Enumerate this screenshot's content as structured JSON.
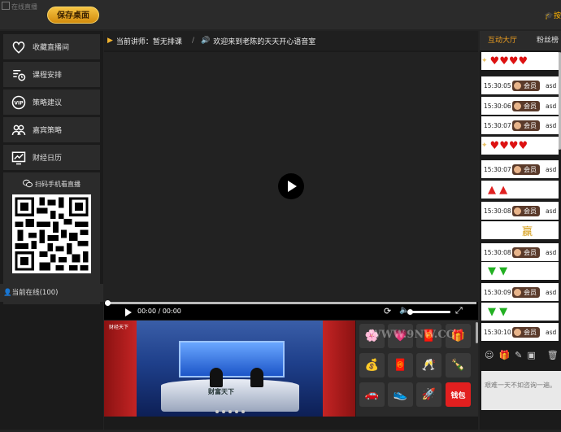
{
  "header": {
    "logo_alt": "在线直播",
    "save_desktop_label": "保存桌面",
    "top_right_label": "按"
  },
  "sidebar": {
    "items": [
      {
        "label": "收藏直播间",
        "icon": "heart-icon"
      },
      {
        "label": "课程安排",
        "icon": "schedule-icon"
      },
      {
        "label": "策略建议",
        "icon": "vip-icon"
      },
      {
        "label": "嘉宾策略",
        "icon": "guests-icon"
      },
      {
        "label": "财经日历",
        "icon": "chart-icon"
      }
    ],
    "qr_title": "扫码手机看直播",
    "online_text": "当前在线(100)"
  },
  "main": {
    "current_teacher": "当前讲师：暂无排课",
    "welcome": "欢迎来到老陈的天天开心语音室",
    "player": {
      "time": "00:00 / 00:00",
      "volume": 1.0,
      "progress": 0.0
    },
    "thumbnail_caption": "财富天下",
    "thumbnail_brand": "财经天下",
    "gifts": {
      "watermark": "WWW.9NW.CC",
      "wallet_label": "钱包",
      "items": [
        "flower-gift-icon",
        "heart-gift-icon",
        "envelope-gift-icon",
        "gold-ingot-gift-icon",
        "red-packet-gift-icon",
        "wine-gift-icon",
        "drink-gift-icon",
        "car-gift-icon",
        "shoe-gift-icon",
        "rocket-gift-icon"
      ]
    }
  },
  "chat": {
    "tabs": {
      "active": "互动大厅",
      "inactive": "粉丝榜"
    },
    "messages": [
      {
        "type": "emoji",
        "content": "♥♥♥♥"
      },
      {
        "type": "msg",
        "time": "15:30:05",
        "badge": "会员",
        "user": "asd"
      },
      {
        "type": "msg",
        "time": "15:30:06",
        "badge": "会员",
        "user": "asd"
      },
      {
        "type": "msg",
        "time": "15:30:07",
        "badge": "会员",
        "user": "asd"
      },
      {
        "type": "emoji",
        "content": "♥♥♥♥"
      },
      {
        "type": "msg",
        "time": "15:30:07",
        "badge": "会员",
        "user": "asd"
      },
      {
        "type": "arrows-up",
        "content": "▲ ▲"
      },
      {
        "type": "msg",
        "time": "15:30:08",
        "badge": "会员",
        "user": "asd"
      },
      {
        "type": "emoji-text",
        "content": "赢"
      },
      {
        "type": "msg",
        "time": "15:30:08",
        "badge": "会员",
        "user": "asd"
      },
      {
        "type": "arrows-down",
        "content": "▼ ▼"
      },
      {
        "type": "msg",
        "time": "15:30:09",
        "badge": "会员",
        "user": "asd"
      },
      {
        "type": "arrows-down",
        "content": "▼ ▼"
      },
      {
        "type": "msg",
        "time": "15:30:10",
        "badge": "会员",
        "user": "asd"
      }
    ],
    "toolbar_icons": [
      "smile-icon",
      "gift-icon",
      "broom-icon",
      "image-icon",
      "trash-icon"
    ],
    "input_placeholder": "艰难一天不如咨询一遍。"
  }
}
